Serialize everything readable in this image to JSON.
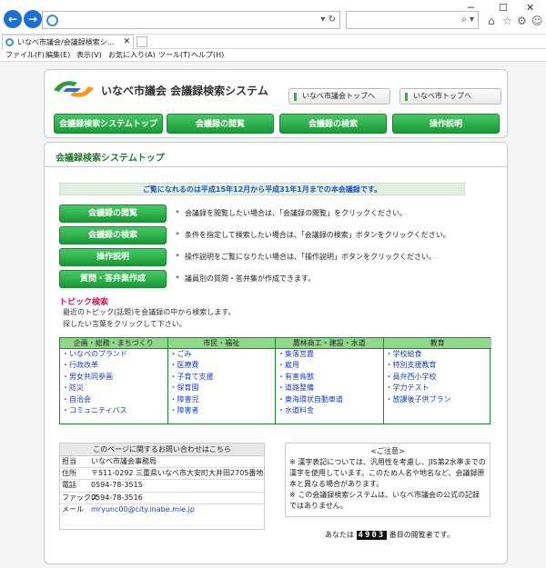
{
  "browser": {
    "tab_title": "いなべ市議会/会議録検索シ...",
    "menu": [
      "ファイル(F)",
      "編集(E)",
      "表示(V)",
      "お気に入り(A)",
      "ツール(T)",
      "ヘルプ(H)"
    ],
    "window_controls": [
      "─",
      "☐",
      "✕"
    ],
    "tool_icons": [
      "⌂",
      "☆",
      "⚙",
      "☺"
    ]
  },
  "header": {
    "site_title": "いなべ市議会 会議録検索システム",
    "links": [
      "いなべ市議会トップへ",
      "いなべ市トップへ"
    ],
    "nav": [
      "会議録検索システムトップ",
      "会議録の閲覧",
      "会議録の検索",
      "操作説明"
    ]
  },
  "main": {
    "heading": "会議録検索システムトップ",
    "period": "ご覧になれるのは平成15年12月から平成31年1月までの本会議録です。",
    "actions": [
      {
        "label": "会議録の閲覧",
        "desc": "会議録を閲覧したい場合は、「会議録の閲覧」をクリックください。"
      },
      {
        "label": "会議録の検索",
        "desc": "条件を指定して検索したい場合は、「会議録の検索」ボタンをクリックください。"
      },
      {
        "label": "操作説明",
        "desc": "操作説明をご覧になりたい場合は、「操作説明」ボタンをクリックください。"
      },
      {
        "label": "質問・答弁集作成",
        "desc": "議員別の質問・答弁集が作成できます。"
      }
    ],
    "topic": {
      "title": "トピック検索",
      "lines": [
        "最近のトピック(話題)を会議録の中から検索します。",
        "探したい言葉をクリックして下さい。"
      ],
      "columns": [
        {
          "head": "企画・総務・まちづくり",
          "items": [
            "・いなべのブランド",
            "・行政改革",
            "・男女共同参画",
            "・防災",
            "・自治会",
            "・コミュニティバス"
          ]
        },
        {
          "head": "市民・福祉",
          "items": [
            "・ごみ",
            "・医療費",
            "・子育て支援",
            "・保育園",
            "・障害児",
            "・障害者"
          ]
        },
        {
          "head": "農林商工・建設・水道",
          "items": [
            "・集落営農",
            "・雇用",
            "・有害鳥獣",
            "・道路整備",
            "・東海環状自動車道",
            "・水道料金"
          ]
        },
        {
          "head": "教育",
          "items": [
            "・学校給食",
            "・特別支援教育",
            "・員弁西小学校",
            "・学力テスト",
            "・放課後子供プラン"
          ]
        }
      ]
    },
    "contact": {
      "head": "このページに関するお問い合わせはこちら",
      "rows": [
        {
          "label": "担当",
          "value": "いなべ市議会事務局"
        },
        {
          "label": "住所",
          "value": "〒511-0292 三重県いなべ市大安町大井田2705番地"
        },
        {
          "label": "電話",
          "value": "0594-78-3515"
        },
        {
          "label": "ファックス",
          "value": "0594-78-3516"
        },
        {
          "label": "メール",
          "value": "mryunc00@city.inabe.mie.jp"
        }
      ]
    },
    "notice": {
      "head": "<ご注意>",
      "lines": [
        "※ 漢字表記については、汎用性を考慮し、JIS第2水準までの漢字を使用しています。このため人名や地名など、会議録原本と異なる場合があります。",
        "※ この会議録検索システムは、いなべ市議会の公式の記録ではありません。"
      ]
    },
    "counter": {
      "prefix": "あなたは",
      "digits": "4903",
      "suffix": "番目の閲覧者です。"
    }
  }
}
